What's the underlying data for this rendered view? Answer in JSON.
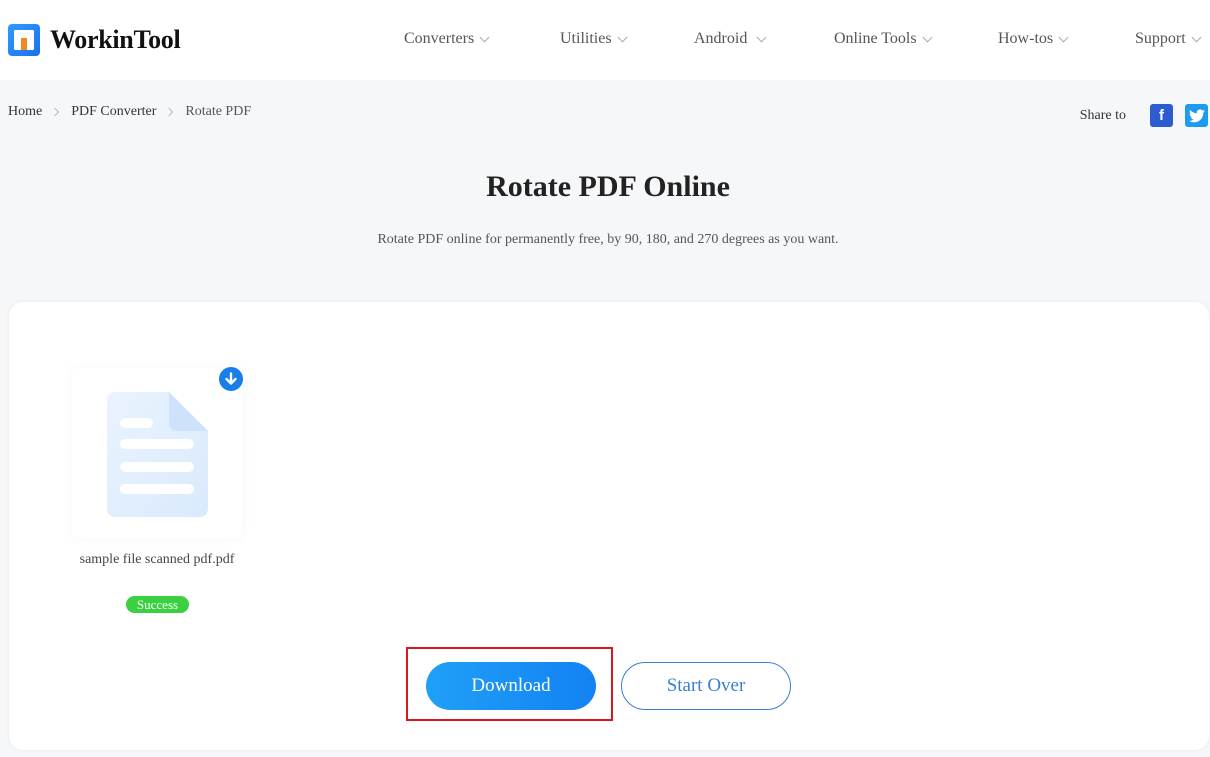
{
  "brand": {
    "name": "WorkinTool",
    "accent": "#1a7ee8"
  },
  "nav": {
    "items": [
      {
        "label": "Converters"
      },
      {
        "label": "Utilities"
      },
      {
        "label": "Android"
      },
      {
        "label": "Online Tools"
      },
      {
        "label": "How-tos"
      },
      {
        "label": "Support"
      }
    ]
  },
  "breadcrumb": {
    "items": [
      {
        "label": "Home"
      },
      {
        "label": "PDF Converter"
      },
      {
        "label": "Rotate PDF"
      }
    ]
  },
  "share": {
    "label": "Share to",
    "facebook_glyph": "f",
    "twitter_icon": "twitter-icon"
  },
  "page": {
    "title": "Rotate PDF Online",
    "subtitle": "Rotate PDF online for permanently free, by 90, 180, and 270 degrees as you want."
  },
  "file": {
    "name": "sample file scanned pdf.pdf",
    "status": "Success",
    "status_color": "#3bd03f",
    "icon": "document-icon",
    "download_icon": "download-circle-icon"
  },
  "actions": {
    "download_label": "Download",
    "start_over_label": "Start Over"
  }
}
